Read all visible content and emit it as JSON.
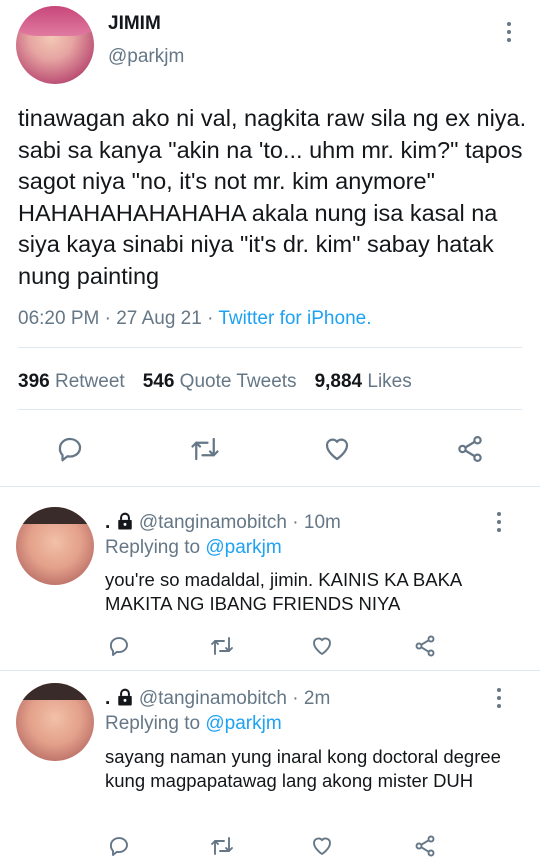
{
  "tweet": {
    "display_name": "JIMIM",
    "handle": "@parkjm",
    "text": "tinawagan ako ni val, nagkita raw sila ng ex niya. sabi sa kanya \"akin na 'to... uhm mr. kim?\" tapos sagot niya \"no, it's not mr. kim anymore\" HAHAHAHAHAHAHA akala nung isa kasal na siya kaya sinabi niya \"it's dr. kim\" sabay hatak nung painting",
    "time": "06:20 PM",
    "date": "27 Aug 21",
    "separator": " · ",
    "source": "Twitter for iPhone.",
    "stats": {
      "retweets": "396",
      "retweets_label": "Retweet",
      "quotes": "546",
      "quotes_label": "Quote Tweets",
      "likes": "9,884",
      "likes_label": "Likes"
    }
  },
  "replies": [
    {
      "dot": ".",
      "handle": "@tanginamobitch",
      "time": "10m",
      "replying_label": "Replying to",
      "replying_to": "@parkjm",
      "text": "you're so madaldal, jimin. KAINIS KA BAKA MAKITA NG IBANG FRIENDS NIYA"
    },
    {
      "dot": ".",
      "handle": "@tanginamobitch",
      "time": "2m",
      "replying_label": "Replying to",
      "replying_to": "@parkjm",
      "text": "sayang naman yung inaral kong doctoral degree kung magpapatawag lang akong mister DUH"
    }
  ],
  "icons": {
    "reply": "reply-icon",
    "retweet": "retweet-icon",
    "like": "heart-icon",
    "share": "share-icon",
    "more": "more-vertical-icon",
    "lock": "lock-icon"
  },
  "colors": {
    "text": "#14171a",
    "secondary": "#657786",
    "link": "#1da1f2",
    "divider": "#e1e8ed"
  }
}
